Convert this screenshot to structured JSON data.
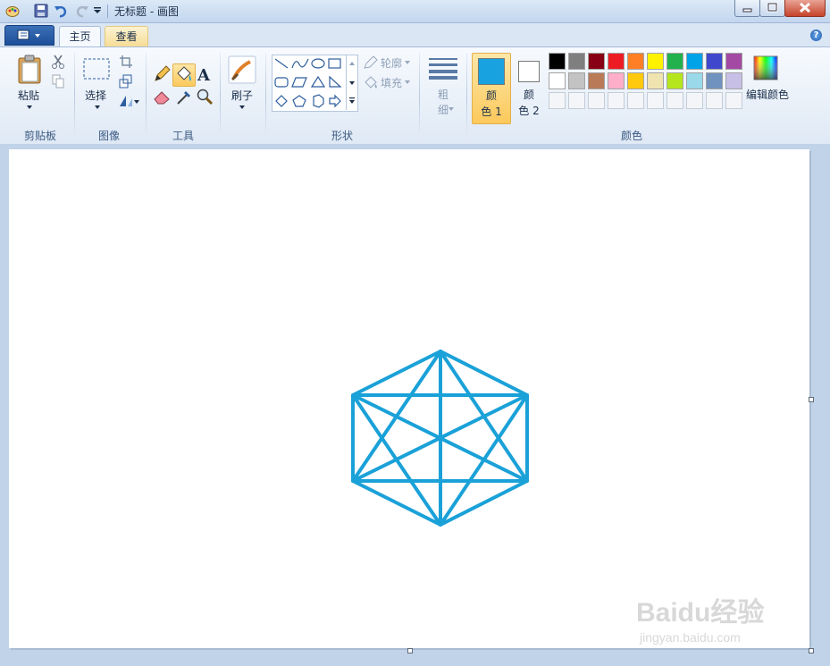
{
  "window": {
    "title": "无标题 - 画图"
  },
  "tabs": [
    {
      "label": "主页"
    },
    {
      "label": "查看"
    }
  ],
  "ribbon": {
    "clipboard": {
      "paste_label": "粘贴",
      "group_label": "剪贴板"
    },
    "image": {
      "select_label": "选择",
      "group_label": "图像"
    },
    "tools": {
      "group_label": "工具"
    },
    "brushes": {
      "label": "刷子"
    },
    "shapes": {
      "outline_label": "轮廓",
      "fill_label": "填充",
      "group_label": "形状"
    },
    "size": {
      "label_1": "粗",
      "label_2": "细"
    },
    "colors": {
      "color1_label_1": "颜",
      "color1_label_2": "色 1",
      "color2_label_1": "颜",
      "color2_label_2": "色 2",
      "edit_label": "编辑颜色",
      "group_label": "颜色",
      "color1": "#18a3e0",
      "color2": "#ffffff",
      "palette_row1": [
        "#000000",
        "#7f7f7f",
        "#880015",
        "#ed1c24",
        "#ff7f27",
        "#fff200",
        "#22b14c",
        "#00a2e8",
        "#3f48cc",
        "#a349a4"
      ],
      "palette_row2": [
        "#ffffff",
        "#c3c3c3",
        "#b97a57",
        "#ffaec9",
        "#ffc90e",
        "#efe4b0",
        "#b5e61d",
        "#99d9ea",
        "#7092be",
        "#c8bfe7"
      ]
    }
  },
  "canvas": {
    "stroke_color": "#1aa1d8"
  },
  "watermark": {
    "brand": "Baidu经验",
    "url": "jingyan.baidu.com"
  }
}
